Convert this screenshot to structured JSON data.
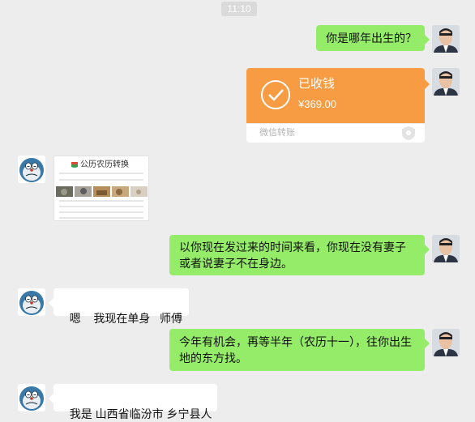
{
  "chat": {
    "time_stamp": "11:10",
    "messages": [
      {
        "side": "right",
        "type": "text",
        "text": "你是哪年出生的？"
      },
      {
        "side": "right",
        "type": "transfer",
        "status": "已收钱",
        "amount": "¥369.00",
        "footer": "微信转账"
      },
      {
        "side": "left",
        "type": "image",
        "title": "公历农历转换"
      },
      {
        "side": "right",
        "type": "text",
        "text": "以你现在发过来的时间来看，你现在没有妻子或者说妻子不在身边。"
      },
      {
        "side": "left",
        "type": "text",
        "text": "嗯    我现在单身   师傅"
      },
      {
        "side": "right",
        "type": "text",
        "text": "今年有机会，再等半年（农历十一），往你出生地的东方找。"
      },
      {
        "side": "left",
        "type": "text",
        "text": "我是 山西省临汾市 乡宁县人"
      }
    ]
  },
  "colors": {
    "background": "#ededed",
    "own_bubble": "#95ec69",
    "other_bubble": "#ffffff",
    "transfer": "#f79c43"
  },
  "icons": {
    "own_avatar": "man-portrait-avatar",
    "other_avatar": "cartoon-robot-cat-avatar",
    "transfer_status": "checkmark-circle-icon",
    "transfer_footer": "shield-icon"
  }
}
